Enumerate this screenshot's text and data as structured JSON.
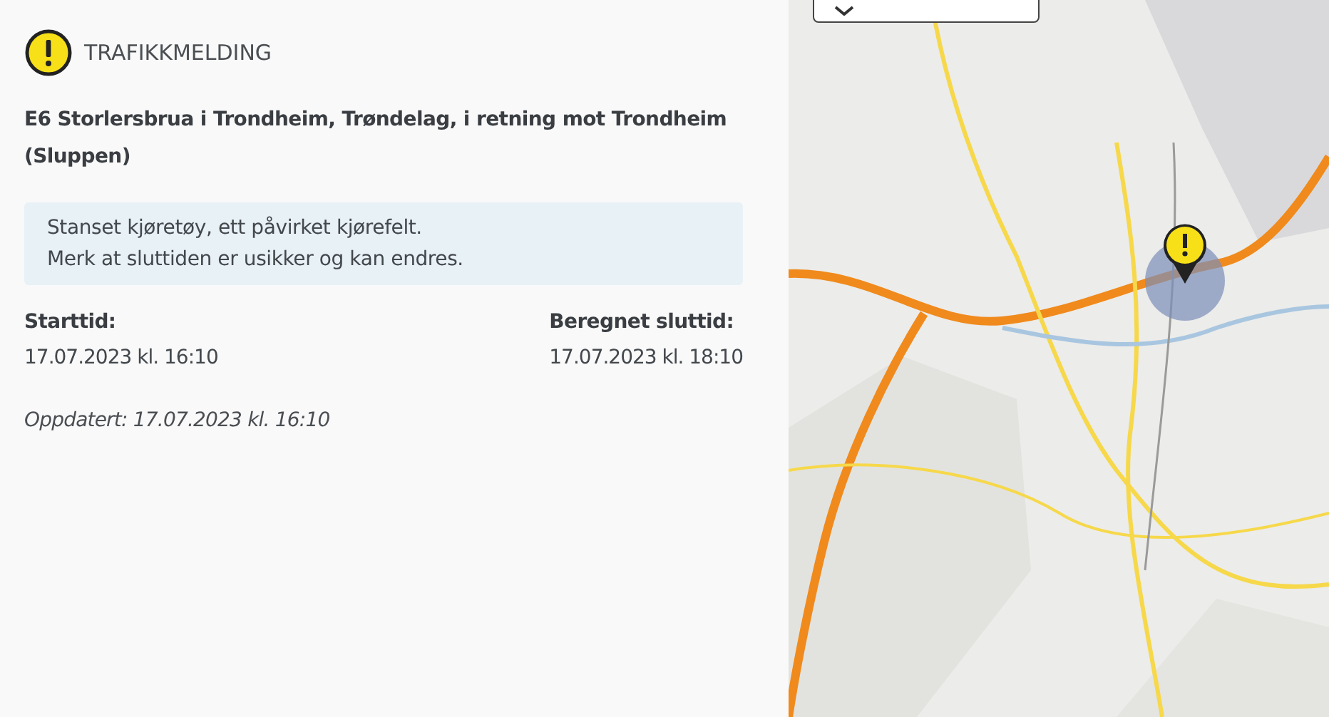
{
  "message": {
    "category": "TRAFIKKMELDING",
    "title": "E6 Storlersbrua i Trondheim, Trøndelag, i retning mot Trondheim (Sluppen)",
    "notes": [
      "Stanset kjøretøy, ett påvirket kjørefelt.",
      "Merk at sluttiden er usikker og kan endres."
    ],
    "times": [
      {
        "label": "Starttid:",
        "value": "17.07.2023 kl. 16:10"
      },
      {
        "label": "Beregnet sluttid:",
        "value": "17.07.2023 kl. 18:10"
      }
    ],
    "updated": "Oppdatert: 17.07.2023 kl. 16:10"
  }
}
